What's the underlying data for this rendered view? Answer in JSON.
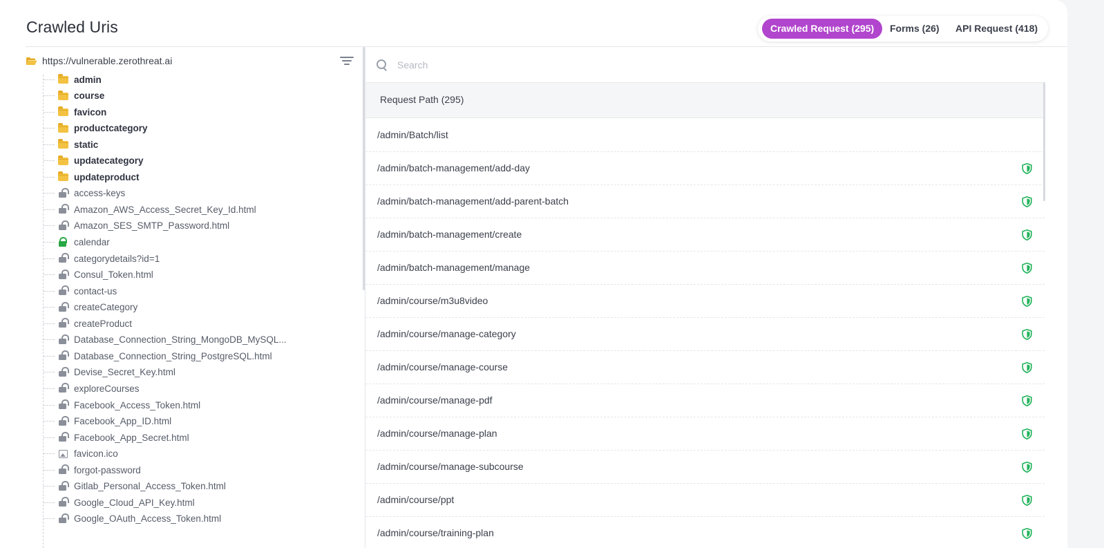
{
  "page": {
    "title": "Crawled Uris"
  },
  "tabs": [
    {
      "label": "Crawled Request (295)",
      "active": true
    },
    {
      "label": "Forms (26)",
      "active": false
    },
    {
      "label": "API Request (418)",
      "active": false
    }
  ],
  "colors": {
    "accent": "#b145cd",
    "folder": "#f3c242",
    "secure": "#28a745",
    "shield": "#21b35a"
  },
  "tree": {
    "root": "https://vulnerable.zerothreat.ai",
    "items": [
      {
        "label": "admin",
        "type": "folder"
      },
      {
        "label": "course",
        "type": "folder"
      },
      {
        "label": "favicon",
        "type": "folder"
      },
      {
        "label": "productcategory",
        "type": "folder"
      },
      {
        "label": "static",
        "type": "folder"
      },
      {
        "label": "updatecategory",
        "type": "folder"
      },
      {
        "label": "updateproduct",
        "type": "folder"
      },
      {
        "label": "access-keys",
        "type": "open-lock"
      },
      {
        "label": "Amazon_AWS_Access_Secret_Key_Id.html",
        "type": "open-lock"
      },
      {
        "label": "Amazon_SES_SMTP_Password.html",
        "type": "open-lock"
      },
      {
        "label": "calendar",
        "type": "closed-lock"
      },
      {
        "label": "categorydetails?id=1",
        "type": "open-lock"
      },
      {
        "label": "Consul_Token.html",
        "type": "open-lock"
      },
      {
        "label": "contact-us",
        "type": "open-lock"
      },
      {
        "label": "createCategory",
        "type": "open-lock"
      },
      {
        "label": "createProduct",
        "type": "open-lock"
      },
      {
        "label": "Database_Connection_String_MongoDB_MySQL...",
        "type": "open-lock"
      },
      {
        "label": "Database_Connection_String_PostgreSQL.html",
        "type": "open-lock"
      },
      {
        "label": "Devise_Secret_Key.html",
        "type": "open-lock"
      },
      {
        "label": "exploreCourses",
        "type": "open-lock"
      },
      {
        "label": "Facebook_Access_Token.html",
        "type": "open-lock"
      },
      {
        "label": "Facebook_App_ID.html",
        "type": "open-lock"
      },
      {
        "label": "Facebook_App_Secret.html",
        "type": "open-lock"
      },
      {
        "label": "favicon.ico",
        "type": "image"
      },
      {
        "label": "forgot-password",
        "type": "open-lock"
      },
      {
        "label": "Gitlab_Personal_Access_Token.html",
        "type": "open-lock"
      },
      {
        "label": "Google_Cloud_API_Key.html",
        "type": "open-lock"
      },
      {
        "label": "Google_OAuth_Access_Token.html",
        "type": "open-lock"
      }
    ]
  },
  "search": {
    "placeholder": "Search"
  },
  "table": {
    "header": "Request Path (295)",
    "rows": [
      {
        "path": "/admin/Batch/list",
        "shield": false
      },
      {
        "path": "/admin/batch-management/add-day",
        "shield": true
      },
      {
        "path": "/admin/batch-management/add-parent-batch",
        "shield": true
      },
      {
        "path": "/admin/batch-management/create",
        "shield": true
      },
      {
        "path": "/admin/batch-management/manage",
        "shield": true
      },
      {
        "path": "/admin/course/m3u8video",
        "shield": true
      },
      {
        "path": "/admin/course/manage-category",
        "shield": true
      },
      {
        "path": "/admin/course/manage-course",
        "shield": true
      },
      {
        "path": "/admin/course/manage-pdf",
        "shield": true
      },
      {
        "path": "/admin/course/manage-plan",
        "shield": true
      },
      {
        "path": "/admin/course/manage-subcourse",
        "shield": true
      },
      {
        "path": "/admin/course/ppt",
        "shield": true
      },
      {
        "path": "/admin/course/training-plan",
        "shield": true
      }
    ]
  }
}
